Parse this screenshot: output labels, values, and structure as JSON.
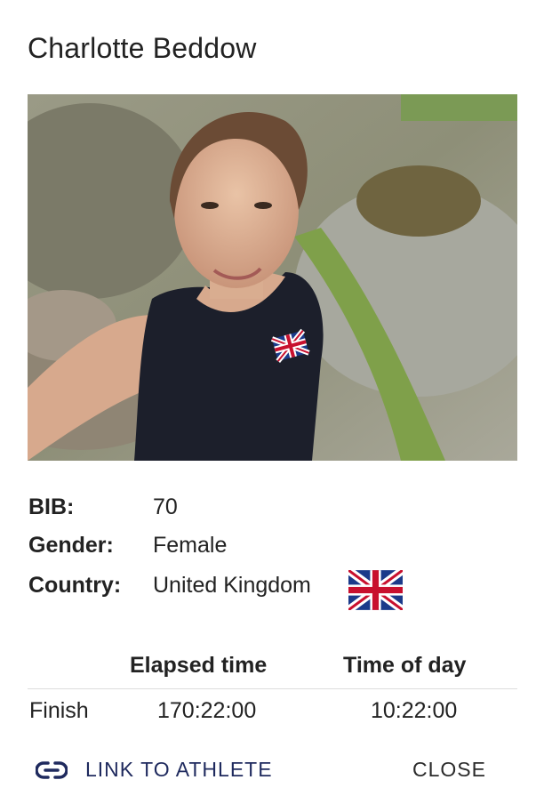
{
  "dialog": {
    "title": "Charlotte Beddow"
  },
  "athlete": {
    "photo_icon": "athlete-photo",
    "fields": [
      {
        "label": "BIB:",
        "value": "70"
      },
      {
        "label": "Gender:",
        "value": "Female"
      },
      {
        "label": "Country:",
        "value": "United Kingdom"
      }
    ],
    "flag_icon": "uk-flag-icon"
  },
  "splits": {
    "columns": [
      "",
      "Elapsed time",
      "Time of day"
    ],
    "rows": [
      {
        "name": "Finish",
        "elapsed": "170:22:00",
        "time_of_day": "10:22:00"
      }
    ]
  },
  "actions": {
    "link_label": "LINK TO ATHLETE",
    "link_icon": "link-icon",
    "close_label": "CLOSE"
  },
  "colors": {
    "accent": "#1f2a5e",
    "text": "#222222",
    "divider": "#dcdcdc"
  }
}
